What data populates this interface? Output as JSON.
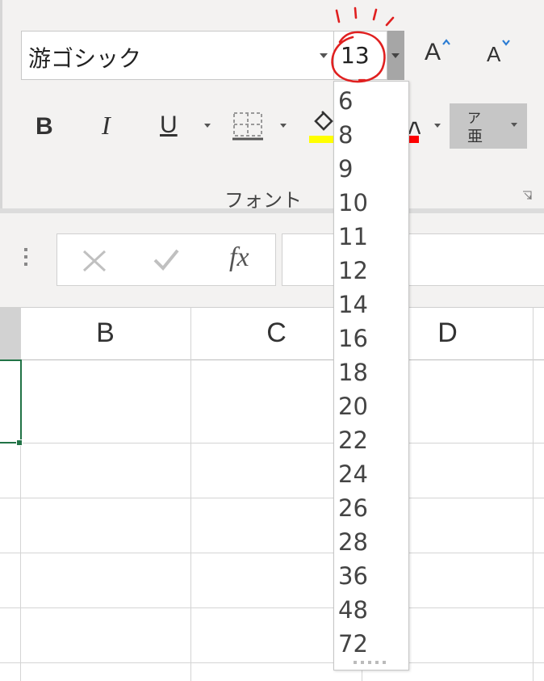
{
  "ribbon": {
    "font_name": "游ゴシック",
    "font_size": "13",
    "grow_label": "A",
    "shrink_label": "A",
    "bold_label": "B",
    "italic_label": "I",
    "underline_label": "U",
    "phonetic_top": "ア",
    "phonetic_bottom": "亜",
    "group_label": "フォント",
    "fill_color": "#ffff00",
    "font_color": "#ff0000"
  },
  "formula_bar": {
    "fx_label": "fx",
    "cancel_icon": "x-icon",
    "enter_icon": "check-icon"
  },
  "grid": {
    "columns": [
      "B",
      "C",
      "D"
    ],
    "selection_color": "#217346"
  },
  "size_dropdown": {
    "options": [
      "6",
      "8",
      "9",
      "10",
      "11",
      "12",
      "14",
      "16",
      "18",
      "20",
      "22",
      "24",
      "26",
      "28",
      "36",
      "48",
      "72"
    ]
  },
  "annotation": {
    "color": "#e02020"
  }
}
